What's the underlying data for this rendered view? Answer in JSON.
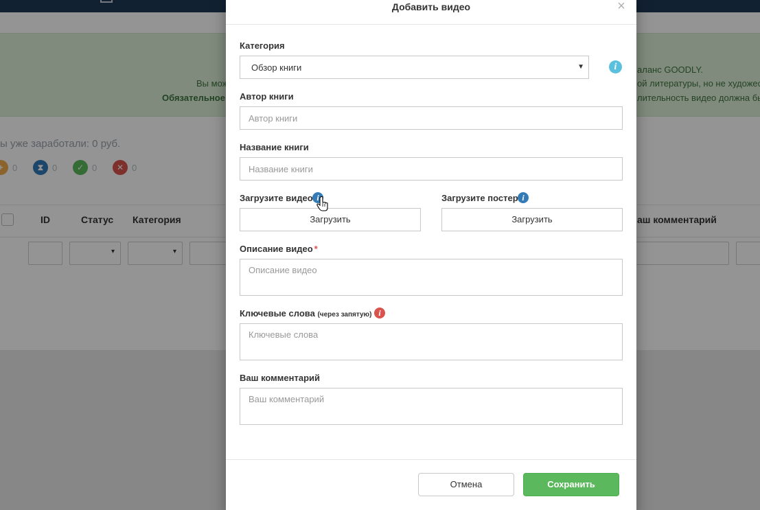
{
  "background": {
    "alert": {
      "line1_left": "Вы мож",
      "line2_left": "Обязательное",
      "line0_right": "аланс GOODLY.",
      "line1_right": "ой литературы, но не художес",
      "line2_right": "лительность видео должна бы"
    },
    "earned_text": "ы уже заработали: 0 руб.",
    "stats": [
      {
        "icon": "plus-icon",
        "color": "#f0ad4e",
        "value": "0"
      },
      {
        "icon": "hourglass-icon",
        "color": "#337ab7",
        "value": "0"
      },
      {
        "icon": "thumbs-up-icon",
        "color": "#5cb85c",
        "value": "0"
      },
      {
        "icon": "thumbs-down-icon",
        "color": "#d9534f",
        "value": "0"
      }
    ],
    "table_headers": {
      "id": "ID",
      "status": "Статус",
      "category": "Категория",
      "comment": "аш комментарий"
    }
  },
  "modal": {
    "title": "Добавить видео",
    "close_label": "×",
    "category": {
      "label": "Категория",
      "value": "Обзор книги"
    },
    "author": {
      "label": "Автор книги",
      "placeholder": "Автор книги"
    },
    "book_title": {
      "label": "Название книги",
      "placeholder": "Название книги"
    },
    "upload_video": {
      "label": "Загрузите видео",
      "button": "Загрузить"
    },
    "upload_poster": {
      "label": "Загрузите постер",
      "button": "Загрузить"
    },
    "description": {
      "label": "Описание видео",
      "required_mark": "*",
      "placeholder": "Описание видео"
    },
    "keywords": {
      "label": "Ключевые слова",
      "hint": "(через запятую)",
      "placeholder": "Ключевые слова"
    },
    "comment": {
      "label": "Ваш комментарий",
      "placeholder": "Ваш комментарий"
    },
    "cancel_label": "Отмена",
    "save_label": "Сохранить"
  },
  "colors": {
    "info_blue": "#5bc0de",
    "info_dark_blue": "#337ab7",
    "info_red": "#d9534f",
    "save_green": "#5cb85c",
    "alert_green": "#dff0d8"
  }
}
